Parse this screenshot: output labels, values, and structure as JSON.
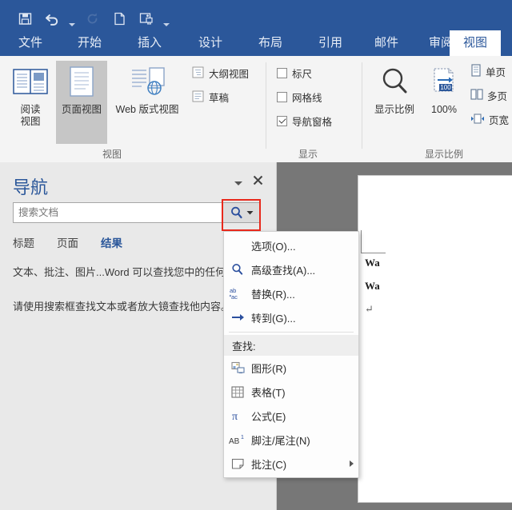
{
  "quick_access": {
    "buttons": [
      {
        "name": "save-icon",
        "label": "保存"
      },
      {
        "name": "undo-icon",
        "label": "撤消"
      },
      {
        "name": "redo-icon",
        "label": "恢复"
      },
      {
        "name": "new-document-icon",
        "label": "新建"
      },
      {
        "name": "touch-mouse-mode-icon",
        "label": "触摸/鼠标模式"
      },
      {
        "name": "customize-quick-access-icon",
        "label": "自定义快速访问工具栏"
      }
    ]
  },
  "ribbon": {
    "tabs": [
      {
        "label": "文件",
        "active": false
      },
      {
        "label": "开始",
        "active": false
      },
      {
        "label": "插入",
        "active": false
      },
      {
        "label": "设计",
        "active": false
      },
      {
        "label": "布局",
        "active": false
      },
      {
        "label": "引用",
        "active": false
      },
      {
        "label": "邮件",
        "active": false
      },
      {
        "label": "审阅",
        "active": false
      },
      {
        "label": "视图",
        "active": true
      }
    ],
    "groups": {
      "view": {
        "label": "视图",
        "read_mode": {
          "line1": "阅读",
          "line2": "视图"
        },
        "print_layout": {
          "line1": "页面视图",
          "line2": ""
        },
        "web_layout": {
          "line1": "Web 版式视图",
          "line2": ""
        },
        "outline": "大纲视图",
        "draft": "草稿"
      },
      "show": {
        "label": "显示",
        "items": [
          {
            "label": "标尺",
            "checked": false
          },
          {
            "label": "网格线",
            "checked": false
          },
          {
            "label": "导航窗格",
            "checked": true
          }
        ]
      },
      "zoom": {
        "label": "显示比例",
        "zoom_button": "显示比例",
        "zoom_100": "100%",
        "one_page": "单页",
        "multiple_pages": "多页",
        "page_width": "页宽"
      }
    }
  },
  "navigation_pane": {
    "title": "导航",
    "collapse_label": "下拉",
    "close_label": "关闭",
    "search": {
      "placeholder": "搜索文档",
      "value": "",
      "button_label": "搜索"
    },
    "tabs": [
      {
        "label": "标题",
        "active": false
      },
      {
        "label": "页面",
        "active": false
      },
      {
        "label": "结果",
        "active": true
      }
    ],
    "body": [
      "文本、批注、图片...Word 可以查找您中的任何内容。",
      "请使用搜索框查找文本或者放大镜查找他内容。"
    ]
  },
  "search_menu": {
    "items": [
      {
        "label": "选项(O)...",
        "accel": "O",
        "text": "选项",
        "suffix": "...",
        "icon": "none",
        "submenu": false
      },
      {
        "label": "高级查找(A)...",
        "accel": "A",
        "text": "高级查找",
        "suffix": "...",
        "icon": "magnifier-icon",
        "submenu": false
      },
      {
        "label": "替换(R)...",
        "accel": "R",
        "text": "替换",
        "suffix": "...",
        "icon": "replace-abac-icon",
        "submenu": false
      },
      {
        "label": "转到(G)...",
        "accel": "G",
        "text": "转到",
        "suffix": "...",
        "icon": "goto-arrow-icon",
        "submenu": false
      }
    ],
    "section_header": "查找:",
    "find_items": [
      {
        "label": "图形(R)",
        "accel": "R",
        "text": "图形",
        "suffix": "",
        "icon": "graphic-icon",
        "submenu": false
      },
      {
        "label": "表格(T)",
        "accel": "T",
        "text": "表格",
        "suffix": "",
        "icon": "table-icon",
        "submenu": false
      },
      {
        "label": "公式(E)",
        "accel": "E",
        "text": "公式",
        "suffix": "",
        "icon": "equation-pi-icon",
        "submenu": false
      },
      {
        "label": "脚注/尾注(N)",
        "accel": "N",
        "text": "脚注/尾注",
        "suffix": "",
        "icon": "footnote-icon",
        "submenu": false
      },
      {
        "label": "批注(C)",
        "accel": "C",
        "text": "批注",
        "suffix": "",
        "icon": "comment-icon",
        "submenu": true
      }
    ]
  },
  "document": {
    "lines": [
      "Wa",
      "Wa"
    ],
    "pilcrow": "↵"
  },
  "colors": {
    "word_blue": "#2b579a",
    "ribbon_bg": "#f4f4f4",
    "pane_bg": "#e9e9e9",
    "highlight_red": "#e8291c",
    "doc_bg": "#777777"
  }
}
